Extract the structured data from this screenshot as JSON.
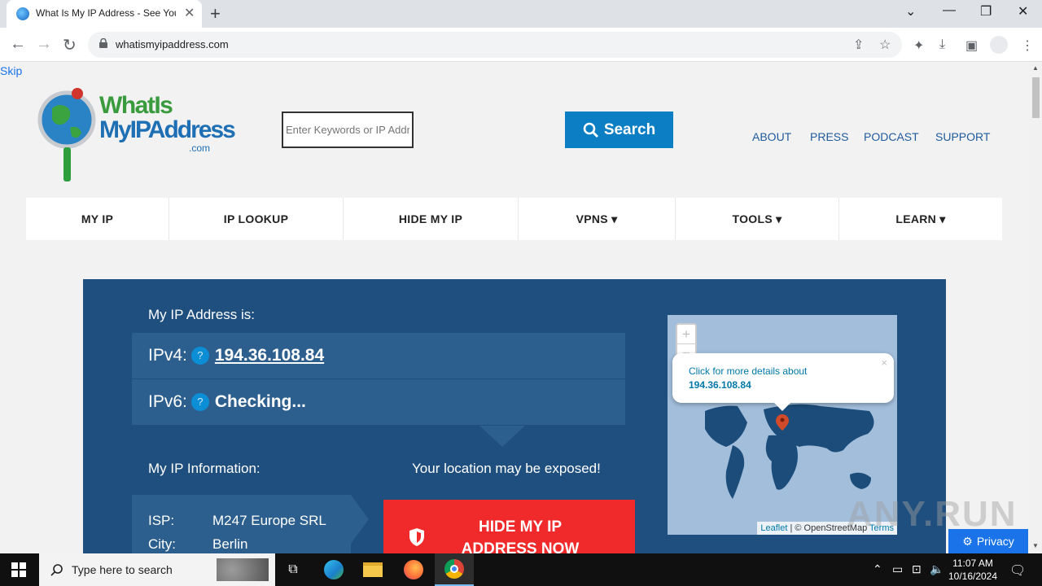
{
  "browser": {
    "tab_title": "What Is My IP Address - See Your",
    "url": "whatismyipaddress.com"
  },
  "site": {
    "skip_label": "Skip",
    "logo": {
      "line1": "WhatIs",
      "line2": "MyIPAddress",
      "line3": ".com"
    },
    "search_placeholder": "Enter Keywords or IP Address",
    "search_label": "Search",
    "top_links": [
      "ABOUT",
      "PRESS",
      "PODCAST",
      "SUPPORT"
    ],
    "nav": [
      {
        "label": "MY IP"
      },
      {
        "label": "IP LOOKUP"
      },
      {
        "label": "HIDE MY IP"
      },
      {
        "label": "VPNS ▾"
      },
      {
        "label": "TOOLS ▾"
      },
      {
        "label": "LEARN ▾"
      }
    ]
  },
  "hero": {
    "ip_heading": "My IP Address is:",
    "ipv4_label": "IPv4:",
    "ipv4_value": "194.36.108.84",
    "ipv6_label": "IPv6:",
    "ipv6_value": "Checking...",
    "help_glyph": "?",
    "info_heading": "My IP Information:",
    "exposed_text": "Your location may be exposed!",
    "isp_label": "ISP:",
    "isp_value": "M247 Europe SRL",
    "city_label": "City:",
    "city_value": "Berlin",
    "hide_button": "HIDE MY IP ADDRESS NOW",
    "map": {
      "zoom_in": "+",
      "zoom_out": "−",
      "popup_line1": "Click for more details about",
      "popup_line2": "194.36.108.84",
      "popup_close": "×",
      "attr_leaflet": "Leaflet",
      "attr_osm": "| © OpenStreetMap",
      "attr_terms": "Terms"
    }
  },
  "privacy_label": "Privacy",
  "watermark": "ANY.RUN",
  "taskbar": {
    "search_placeholder": "Type here to search",
    "time": "11:07 AM",
    "date": "10/16/2024"
  },
  "colors": {
    "hero_bg": "#1f4f7f",
    "accent_blue": "#0b7ec4",
    "hide_red": "#f02a2a"
  }
}
